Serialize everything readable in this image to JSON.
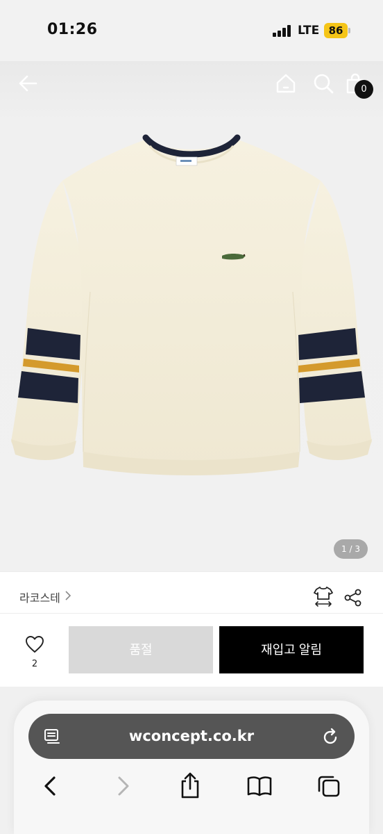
{
  "status_bar": {
    "time": "01:26",
    "network": "LTE",
    "battery": "86"
  },
  "nav": {
    "back_icon": "arrow-left-icon",
    "home_icon": "home-icon",
    "search_icon": "search-icon",
    "cart_icon": "shopping-bag-icon",
    "cart_count": "0"
  },
  "product": {
    "image_counter": "1 / 3",
    "brand": "라코스테",
    "size_icon": "shirt-size-icon",
    "share_icon": "share-icon",
    "colors": {
      "body": "#f4efdd",
      "navy": "#1e2438",
      "mustard": "#d49a2c"
    }
  },
  "actions": {
    "wish_icon": "heart-icon",
    "wish_count": "2",
    "soldout_label": "품절",
    "restock_label": "재입고 알림"
  },
  "browser": {
    "reader_icon": "reader-icon",
    "url": "wconcept.co.kr",
    "reload_icon": "reload-icon",
    "toolbar": [
      "back-icon",
      "forward-icon",
      "share-icon",
      "bookmarks-icon",
      "tabs-icon"
    ]
  }
}
